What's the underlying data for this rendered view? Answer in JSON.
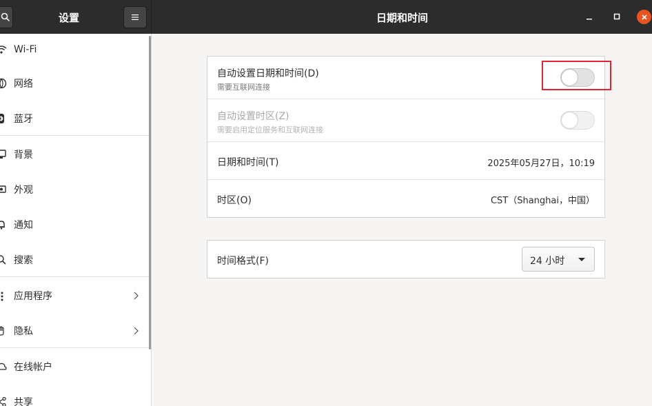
{
  "window": {
    "sidebar_title": "设置",
    "main_title": "日期和时间",
    "close_color": "#e95420"
  },
  "sidebar": {
    "items": [
      {
        "label": "Wi-Fi",
        "icon": "wifi-icon"
      },
      {
        "label": "网络",
        "icon": "network-icon"
      },
      {
        "label": "蓝牙",
        "icon": "bluetooth-icon"
      },
      {
        "label": "背景",
        "icon": "background-icon"
      },
      {
        "label": "外观",
        "icon": "appearance-icon"
      },
      {
        "label": "通知",
        "icon": "bell-icon"
      },
      {
        "label": "搜索",
        "icon": "search-icon"
      },
      {
        "label": "应用程序",
        "icon": "apps-icon",
        "chevron": true
      },
      {
        "label": "隐私",
        "icon": "hand-icon",
        "chevron": true
      },
      {
        "label": "在线帐户",
        "icon": "cloud-icon"
      },
      {
        "label": "共享",
        "icon": "share-icon"
      }
    ]
  },
  "settings": {
    "auto_datetime": {
      "title": "自动设置日期和时间(D)",
      "subtitle": "需要互联网连接",
      "enabled": false
    },
    "auto_timezone": {
      "title": "自动设置时区(Z)",
      "subtitle": "需要启用定位服务和互联网连接",
      "enabled": false,
      "disabled": true
    },
    "datetime": {
      "title": "日期和时间(T)",
      "value": "2025年05月27日，10:19"
    },
    "timezone": {
      "title": "时区(O)",
      "value": "CST（Shanghai，中国）"
    },
    "time_format": {
      "title": "时间格式(F)",
      "selected": "24 小时"
    }
  },
  "colors": {
    "highlight": "#e0252f"
  }
}
